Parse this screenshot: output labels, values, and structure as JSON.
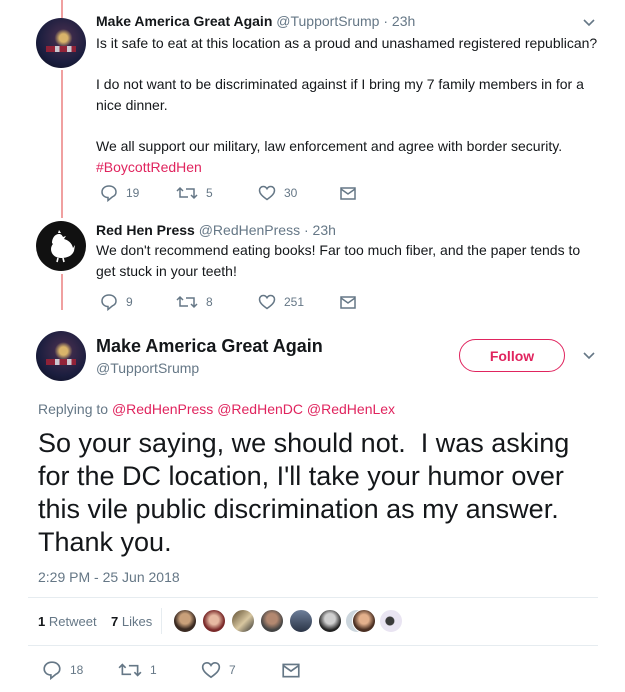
{
  "tweet1": {
    "name": "Make America Great Again",
    "handle": "@TupportSrump",
    "time": "23h",
    "lines": [
      "Is it safe to eat at this location as a proud and unashamed registered republican?",
      "I do not want to be discriminated against if I bring my 7 family members in for a",
      "nice dinner.",
      "We all support our military, law enforcement and agree with border security."
    ],
    "hashtag": "#BoycottRedHen",
    "actions": {
      "replies": "19",
      "retweets": "5",
      "likes": "30"
    }
  },
  "tweet2": {
    "name": "Red Hen Press",
    "handle": "@RedHenPress",
    "time": "23h",
    "lines": [
      "We don't recommend eating books! Far too much fiber, and the paper tends to",
      "get stuck in your teeth!"
    ],
    "actions": {
      "replies": "9",
      "retweets": "8",
      "likes": "251"
    }
  },
  "focus": {
    "name": "Make America Great Again",
    "handle": "@TupportSrump",
    "follow_label": "Follow",
    "replying_prefix": "Replying to",
    "mentions": [
      "@RedHenPress",
      "@RedHenDC",
      "@RedHenLex"
    ],
    "lines": [
      "So your saying, we should not.  I was asking",
      "for the DC location, I'll take your humor over",
      "this vile public discrimination as my answer.",
      "Thank you."
    ],
    "timestamp": "2:29 PM - 25 Jun 2018",
    "retweet_count": "1",
    "retweet_label": "Retweet",
    "like_count": "7",
    "like_label": "Likes",
    "actions": {
      "replies": "18",
      "retweets": "1",
      "likes": "7"
    }
  },
  "colors": {
    "accent": "#e0245e",
    "muted": "#657786",
    "thread": "#f0a0a0"
  },
  "icons": [
    "reply-icon",
    "retweet-icon",
    "like-icon",
    "message-icon",
    "chevron-down-icon"
  ]
}
